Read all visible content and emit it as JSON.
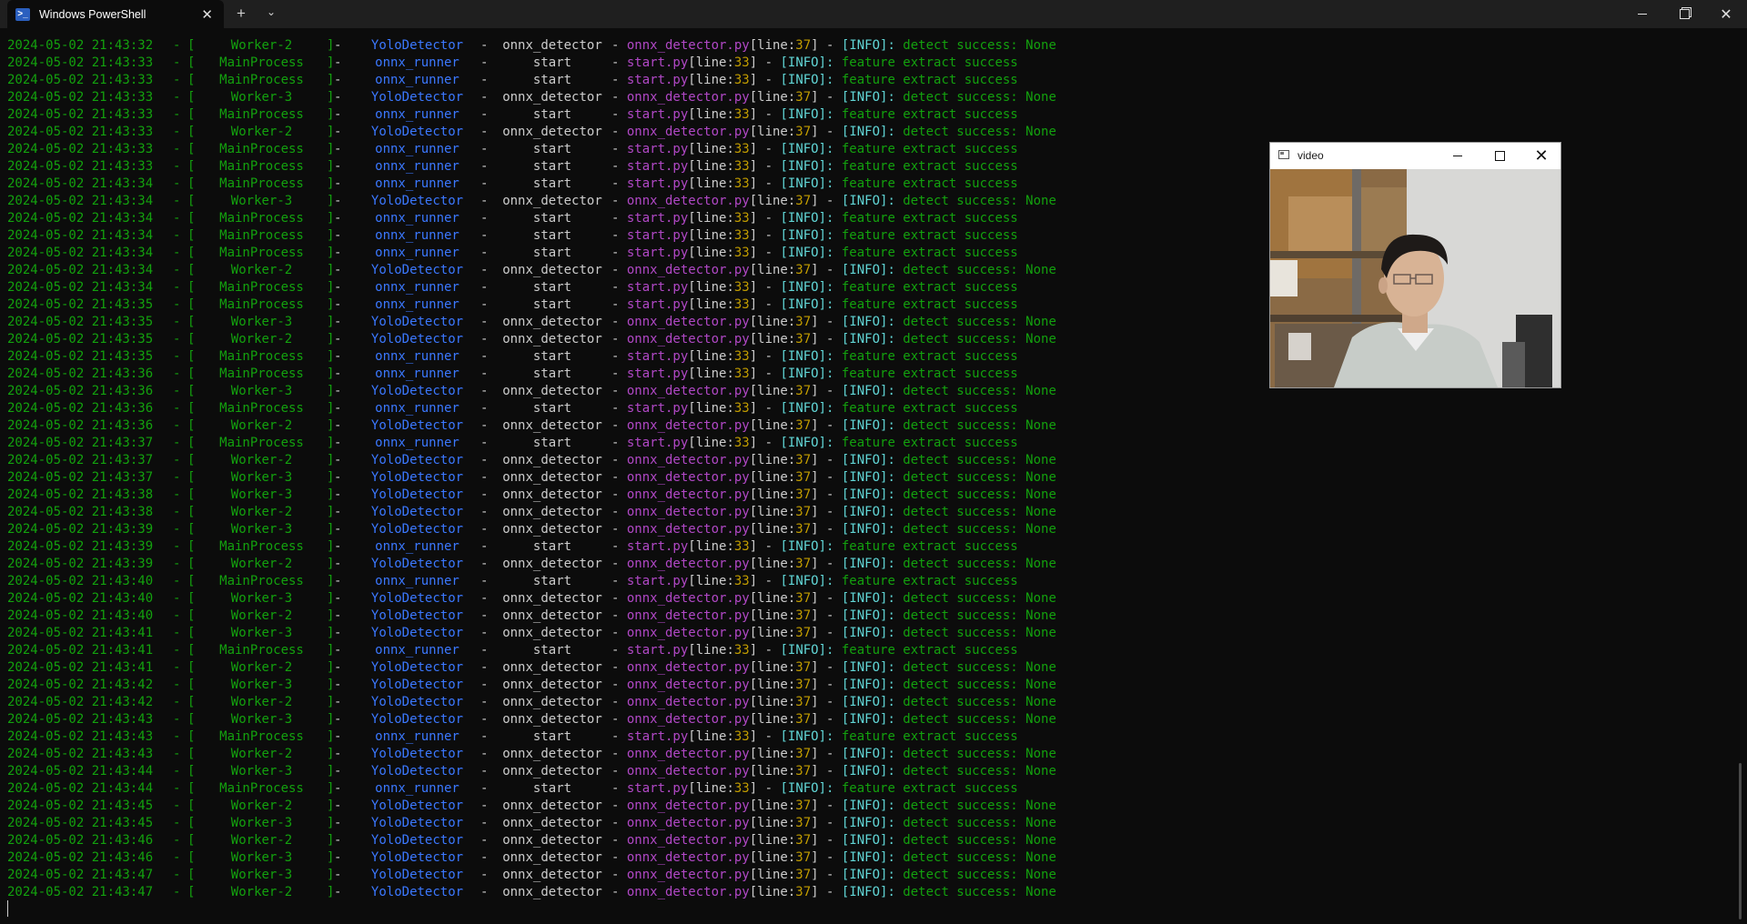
{
  "window": {
    "tab_title": "Windows PowerShell",
    "tab_icon": "powershell-icon",
    "tab_icon_glyph": ">_",
    "new_tab": "+",
    "dropdown": "⌄",
    "close": "✕"
  },
  "video_window": {
    "title": "video",
    "close": "✕"
  },
  "log": {
    "rows": [
      {
        "ts": "2024-05-02 21:43:32",
        "proc": "Worker-2",
        "cls": "YoloDetector",
        "mod": "onnx_detector",
        "file": "onnx_detector.py",
        "line": "37",
        "msg": "detect success: None"
      },
      {
        "ts": "2024-05-02 21:43:33",
        "proc": "MainProcess",
        "cls": "onnx_runner",
        "mod": "start",
        "file": "start.py",
        "line": "33",
        "msg": "feature extract success"
      },
      {
        "ts": "2024-05-02 21:43:33",
        "proc": "MainProcess",
        "cls": "onnx_runner",
        "mod": "start",
        "file": "start.py",
        "line": "33",
        "msg": "feature extract success"
      },
      {
        "ts": "2024-05-02 21:43:33",
        "proc": "Worker-3",
        "cls": "YoloDetector",
        "mod": "onnx_detector",
        "file": "onnx_detector.py",
        "line": "37",
        "msg": "detect success: None"
      },
      {
        "ts": "2024-05-02 21:43:33",
        "proc": "MainProcess",
        "cls": "onnx_runner",
        "mod": "start",
        "file": "start.py",
        "line": "33",
        "msg": "feature extract success"
      },
      {
        "ts": "2024-05-02 21:43:33",
        "proc": "Worker-2",
        "cls": "YoloDetector",
        "mod": "onnx_detector",
        "file": "onnx_detector.py",
        "line": "37",
        "msg": "detect success: None"
      },
      {
        "ts": "2024-05-02 21:43:33",
        "proc": "MainProcess",
        "cls": "onnx_runner",
        "mod": "start",
        "file": "start.py",
        "line": "33",
        "msg": "feature extract success"
      },
      {
        "ts": "2024-05-02 21:43:33",
        "proc": "MainProcess",
        "cls": "onnx_runner",
        "mod": "start",
        "file": "start.py",
        "line": "33",
        "msg": "feature extract success"
      },
      {
        "ts": "2024-05-02 21:43:34",
        "proc": "MainProcess",
        "cls": "onnx_runner",
        "mod": "start",
        "file": "start.py",
        "line": "33",
        "msg": "feature extract success"
      },
      {
        "ts": "2024-05-02 21:43:34",
        "proc": "Worker-3",
        "cls": "YoloDetector",
        "mod": "onnx_detector",
        "file": "onnx_detector.py",
        "line": "37",
        "msg": "detect success: None"
      },
      {
        "ts": "2024-05-02 21:43:34",
        "proc": "MainProcess",
        "cls": "onnx_runner",
        "mod": "start",
        "file": "start.py",
        "line": "33",
        "msg": "feature extract success"
      },
      {
        "ts": "2024-05-02 21:43:34",
        "proc": "MainProcess",
        "cls": "onnx_runner",
        "mod": "start",
        "file": "start.py",
        "line": "33",
        "msg": "feature extract success"
      },
      {
        "ts": "2024-05-02 21:43:34",
        "proc": "MainProcess",
        "cls": "onnx_runner",
        "mod": "start",
        "file": "start.py",
        "line": "33",
        "msg": "feature extract success"
      },
      {
        "ts": "2024-05-02 21:43:34",
        "proc": "Worker-2",
        "cls": "YoloDetector",
        "mod": "onnx_detector",
        "file": "onnx_detector.py",
        "line": "37",
        "msg": "detect success: None"
      },
      {
        "ts": "2024-05-02 21:43:34",
        "proc": "MainProcess",
        "cls": "onnx_runner",
        "mod": "start",
        "file": "start.py",
        "line": "33",
        "msg": "feature extract success"
      },
      {
        "ts": "2024-05-02 21:43:35",
        "proc": "MainProcess",
        "cls": "onnx_runner",
        "mod": "start",
        "file": "start.py",
        "line": "33",
        "msg": "feature extract success"
      },
      {
        "ts": "2024-05-02 21:43:35",
        "proc": "Worker-3",
        "cls": "YoloDetector",
        "mod": "onnx_detector",
        "file": "onnx_detector.py",
        "line": "37",
        "msg": "detect success: None"
      },
      {
        "ts": "2024-05-02 21:43:35",
        "proc": "Worker-2",
        "cls": "YoloDetector",
        "mod": "onnx_detector",
        "file": "onnx_detector.py",
        "line": "37",
        "msg": "detect success: None"
      },
      {
        "ts": "2024-05-02 21:43:35",
        "proc": "MainProcess",
        "cls": "onnx_runner",
        "mod": "start",
        "file": "start.py",
        "line": "33",
        "msg": "feature extract success"
      },
      {
        "ts": "2024-05-02 21:43:36",
        "proc": "MainProcess",
        "cls": "onnx_runner",
        "mod": "start",
        "file": "start.py",
        "line": "33",
        "msg": "feature extract success"
      },
      {
        "ts": "2024-05-02 21:43:36",
        "proc": "Worker-3",
        "cls": "YoloDetector",
        "mod": "onnx_detector",
        "file": "onnx_detector.py",
        "line": "37",
        "msg": "detect success: None"
      },
      {
        "ts": "2024-05-02 21:43:36",
        "proc": "MainProcess",
        "cls": "onnx_runner",
        "mod": "start",
        "file": "start.py",
        "line": "33",
        "msg": "feature extract success"
      },
      {
        "ts": "2024-05-02 21:43:36",
        "proc": "Worker-2",
        "cls": "YoloDetector",
        "mod": "onnx_detector",
        "file": "onnx_detector.py",
        "line": "37",
        "msg": "detect success: None"
      },
      {
        "ts": "2024-05-02 21:43:37",
        "proc": "MainProcess",
        "cls": "onnx_runner",
        "mod": "start",
        "file": "start.py",
        "line": "33",
        "msg": "feature extract success"
      },
      {
        "ts": "2024-05-02 21:43:37",
        "proc": "Worker-2",
        "cls": "YoloDetector",
        "mod": "onnx_detector",
        "file": "onnx_detector.py",
        "line": "37",
        "msg": "detect success: None"
      },
      {
        "ts": "2024-05-02 21:43:37",
        "proc": "Worker-3",
        "cls": "YoloDetector",
        "mod": "onnx_detector",
        "file": "onnx_detector.py",
        "line": "37",
        "msg": "detect success: None"
      },
      {
        "ts": "2024-05-02 21:43:38",
        "proc": "Worker-3",
        "cls": "YoloDetector",
        "mod": "onnx_detector",
        "file": "onnx_detector.py",
        "line": "37",
        "msg": "detect success: None"
      },
      {
        "ts": "2024-05-02 21:43:38",
        "proc": "Worker-2",
        "cls": "YoloDetector",
        "mod": "onnx_detector",
        "file": "onnx_detector.py",
        "line": "37",
        "msg": "detect success: None"
      },
      {
        "ts": "2024-05-02 21:43:39",
        "proc": "Worker-3",
        "cls": "YoloDetector",
        "mod": "onnx_detector",
        "file": "onnx_detector.py",
        "line": "37",
        "msg": "detect success: None"
      },
      {
        "ts": "2024-05-02 21:43:39",
        "proc": "MainProcess",
        "cls": "onnx_runner",
        "mod": "start",
        "file": "start.py",
        "line": "33",
        "msg": "feature extract success"
      },
      {
        "ts": "2024-05-02 21:43:39",
        "proc": "Worker-2",
        "cls": "YoloDetector",
        "mod": "onnx_detector",
        "file": "onnx_detector.py",
        "line": "37",
        "msg": "detect success: None"
      },
      {
        "ts": "2024-05-02 21:43:40",
        "proc": "MainProcess",
        "cls": "onnx_runner",
        "mod": "start",
        "file": "start.py",
        "line": "33",
        "msg": "feature extract success"
      },
      {
        "ts": "2024-05-02 21:43:40",
        "proc": "Worker-3",
        "cls": "YoloDetector",
        "mod": "onnx_detector",
        "file": "onnx_detector.py",
        "line": "37",
        "msg": "detect success: None"
      },
      {
        "ts": "2024-05-02 21:43:40",
        "proc": "Worker-2",
        "cls": "YoloDetector",
        "mod": "onnx_detector",
        "file": "onnx_detector.py",
        "line": "37",
        "msg": "detect success: None"
      },
      {
        "ts": "2024-05-02 21:43:41",
        "proc": "Worker-3",
        "cls": "YoloDetector",
        "mod": "onnx_detector",
        "file": "onnx_detector.py",
        "line": "37",
        "msg": "detect success: None"
      },
      {
        "ts": "2024-05-02 21:43:41",
        "proc": "MainProcess",
        "cls": "onnx_runner",
        "mod": "start",
        "file": "start.py",
        "line": "33",
        "msg": "feature extract success"
      },
      {
        "ts": "2024-05-02 21:43:41",
        "proc": "Worker-2",
        "cls": "YoloDetector",
        "mod": "onnx_detector",
        "file": "onnx_detector.py",
        "line": "37",
        "msg": "detect success: None"
      },
      {
        "ts": "2024-05-02 21:43:42",
        "proc": "Worker-3",
        "cls": "YoloDetector",
        "mod": "onnx_detector",
        "file": "onnx_detector.py",
        "line": "37",
        "msg": "detect success: None"
      },
      {
        "ts": "2024-05-02 21:43:42",
        "proc": "Worker-2",
        "cls": "YoloDetector",
        "mod": "onnx_detector",
        "file": "onnx_detector.py",
        "line": "37",
        "msg": "detect success: None"
      },
      {
        "ts": "2024-05-02 21:43:43",
        "proc": "Worker-3",
        "cls": "YoloDetector",
        "mod": "onnx_detector",
        "file": "onnx_detector.py",
        "line": "37",
        "msg": "detect success: None"
      },
      {
        "ts": "2024-05-02 21:43:43",
        "proc": "MainProcess",
        "cls": "onnx_runner",
        "mod": "start",
        "file": "start.py",
        "line": "33",
        "msg": "feature extract success"
      },
      {
        "ts": "2024-05-02 21:43:43",
        "proc": "Worker-2",
        "cls": "YoloDetector",
        "mod": "onnx_detector",
        "file": "onnx_detector.py",
        "line": "37",
        "msg": "detect success: None"
      },
      {
        "ts": "2024-05-02 21:43:44",
        "proc": "Worker-3",
        "cls": "YoloDetector",
        "mod": "onnx_detector",
        "file": "onnx_detector.py",
        "line": "37",
        "msg": "detect success: None"
      },
      {
        "ts": "2024-05-02 21:43:44",
        "proc": "MainProcess",
        "cls": "onnx_runner",
        "mod": "start",
        "file": "start.py",
        "line": "33",
        "msg": "feature extract success"
      },
      {
        "ts": "2024-05-02 21:43:45",
        "proc": "Worker-2",
        "cls": "YoloDetector",
        "mod": "onnx_detector",
        "file": "onnx_detector.py",
        "line": "37",
        "msg": "detect success: None"
      },
      {
        "ts": "2024-05-02 21:43:45",
        "proc": "Worker-3",
        "cls": "YoloDetector",
        "mod": "onnx_detector",
        "file": "onnx_detector.py",
        "line": "37",
        "msg": "detect success: None"
      },
      {
        "ts": "2024-05-02 21:43:46",
        "proc": "Worker-2",
        "cls": "YoloDetector",
        "mod": "onnx_detector",
        "file": "onnx_detector.py",
        "line": "37",
        "msg": "detect success: None"
      },
      {
        "ts": "2024-05-02 21:43:46",
        "proc": "Worker-3",
        "cls": "YoloDetector",
        "mod": "onnx_detector",
        "file": "onnx_detector.py",
        "line": "37",
        "msg": "detect success: None"
      },
      {
        "ts": "2024-05-02 21:43:47",
        "proc": "Worker-3",
        "cls": "YoloDetector",
        "mod": "onnx_detector",
        "file": "onnx_detector.py",
        "line": "37",
        "msg": "detect success: None"
      },
      {
        "ts": "2024-05-02 21:43:47",
        "proc": "Worker-2",
        "cls": "YoloDetector",
        "mod": "onnx_detector",
        "file": "onnx_detector.py",
        "line": "37",
        "msg": "detect success: None"
      }
    ]
  }
}
